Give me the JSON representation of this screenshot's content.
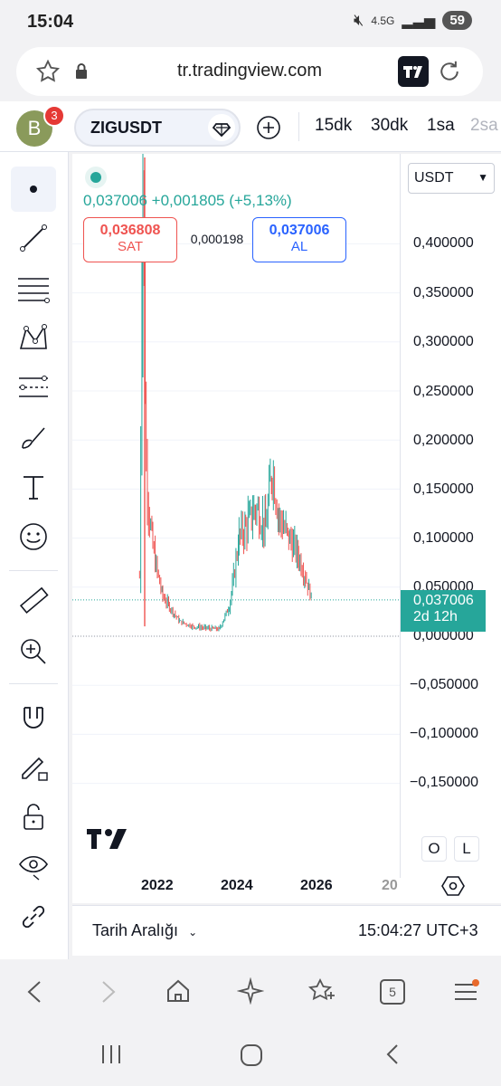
{
  "status": {
    "time": "15:04",
    "network": "4.5G",
    "battery": "59"
  },
  "browser": {
    "url": "tr.tradingview.com"
  },
  "header": {
    "avatar_letter": "B",
    "notif_count": "3",
    "symbol": "ZIGUSDT",
    "intervals": [
      "15dk",
      "30dk",
      "1sa",
      "2sa"
    ]
  },
  "chart": {
    "currency": "USDT",
    "last_price": "0,037006",
    "change": "+0,001805",
    "change_pct": "(+5,13%)",
    "sell_price": "0,036808",
    "sell_label": "SAT",
    "spread": "0,000198",
    "buy_price": "0,037006",
    "buy_label": "AL",
    "price_ticks": [
      "0,400000",
      "0,350000",
      "0,300000",
      "0,250000",
      "0,200000",
      "0,150000",
      "0,100000",
      "0,050000",
      "0,000000",
      "−0,050000",
      "−0,100000",
      "−0,150000"
    ],
    "current_tag_price": "0,037006",
    "current_tag_countdown": "2d 12h",
    "years": [
      "2022",
      "2024",
      "2026",
      "20"
    ],
    "o_label": "O",
    "l_label": "L",
    "date_range_label": "Tarih Aralığı",
    "clock": "15:04:27 UTC+3",
    "colors": {
      "up": "#26a69a",
      "down": "#ef5350",
      "accent": "#2962ff"
    }
  },
  "chart_data": {
    "type": "candlestick",
    "title": "",
    "xlabel": "",
    "ylabel": "",
    "ylim": [
      -0.2,
      0.45
    ],
    "x": [
      "2021-09",
      "2021-10",
      "2021-11",
      "2021-12",
      "2022-01",
      "2022-02",
      "2022-04",
      "2022-06",
      "2022-09",
      "2023-01",
      "2023-05",
      "2023-09",
      "2023-12",
      "2024-01",
      "2024-03",
      "2024-05",
      "2024-08",
      "2024-11",
      "2025-01",
      "2025-03",
      "2025-06",
      "2025-09",
      "2025-11",
      "2026-01"
    ],
    "values": [
      0.06,
      0.48,
      0.17,
      0.12,
      0.09,
      0.07,
      0.04,
      0.03,
      0.015,
      0.01,
      0.008,
      0.007,
      0.03,
      0.05,
      0.1,
      0.11,
      0.13,
      0.11,
      0.17,
      0.12,
      0.1,
      0.08,
      0.06,
      0.037
    ]
  }
}
